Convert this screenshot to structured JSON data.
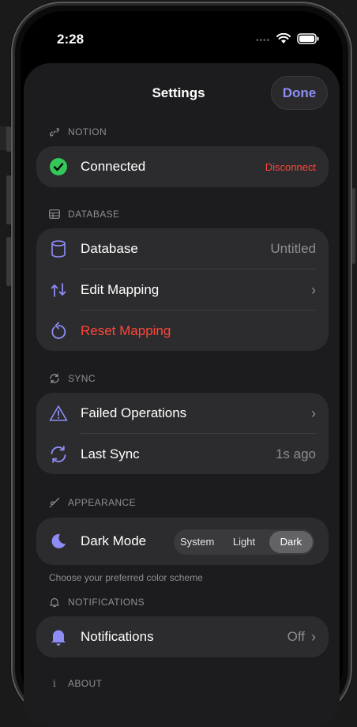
{
  "status_bar": {
    "time": "2:28",
    "signal_icon": "cellular-dots-icon",
    "wifi_icon": "wifi-icon",
    "battery_icon": "battery-icon"
  },
  "header": {
    "title": "Settings",
    "done_label": "Done"
  },
  "colors": {
    "accent": "#8e8df5",
    "success": "#34c759",
    "danger": "#ff453a",
    "card": "#2c2c2e",
    "sheet": "#1c1c1e"
  },
  "sections": {
    "notion": {
      "title": "NOTION",
      "icon": "link-icon",
      "connected_label": "Connected",
      "disconnect_label": "Disconnect"
    },
    "database": {
      "title": "DATABASE",
      "icon": "table-icon",
      "rows": {
        "database_label": "Database",
        "database_value": "Untitled",
        "edit_mapping_label": "Edit Mapping",
        "reset_mapping_label": "Reset Mapping"
      }
    },
    "sync": {
      "title": "SYNC",
      "icon": "sync-icon",
      "rows": {
        "failed_label": "Failed Operations",
        "last_sync_label": "Last Sync",
        "last_sync_value": "1s ago"
      }
    },
    "appearance": {
      "title": "APPEARANCE",
      "icon": "paintbrush-icon",
      "dark_mode_label": "Dark Mode",
      "options": [
        "System",
        "Light",
        "Dark"
      ],
      "selected": "Dark",
      "footnote": "Choose your preferred color scheme"
    },
    "notifications": {
      "title": "NOTIFICATIONS",
      "icon": "bell-icon",
      "label": "Notifications",
      "value": "Off"
    },
    "about": {
      "title": "ABOUT",
      "icon": "info-icon"
    }
  }
}
